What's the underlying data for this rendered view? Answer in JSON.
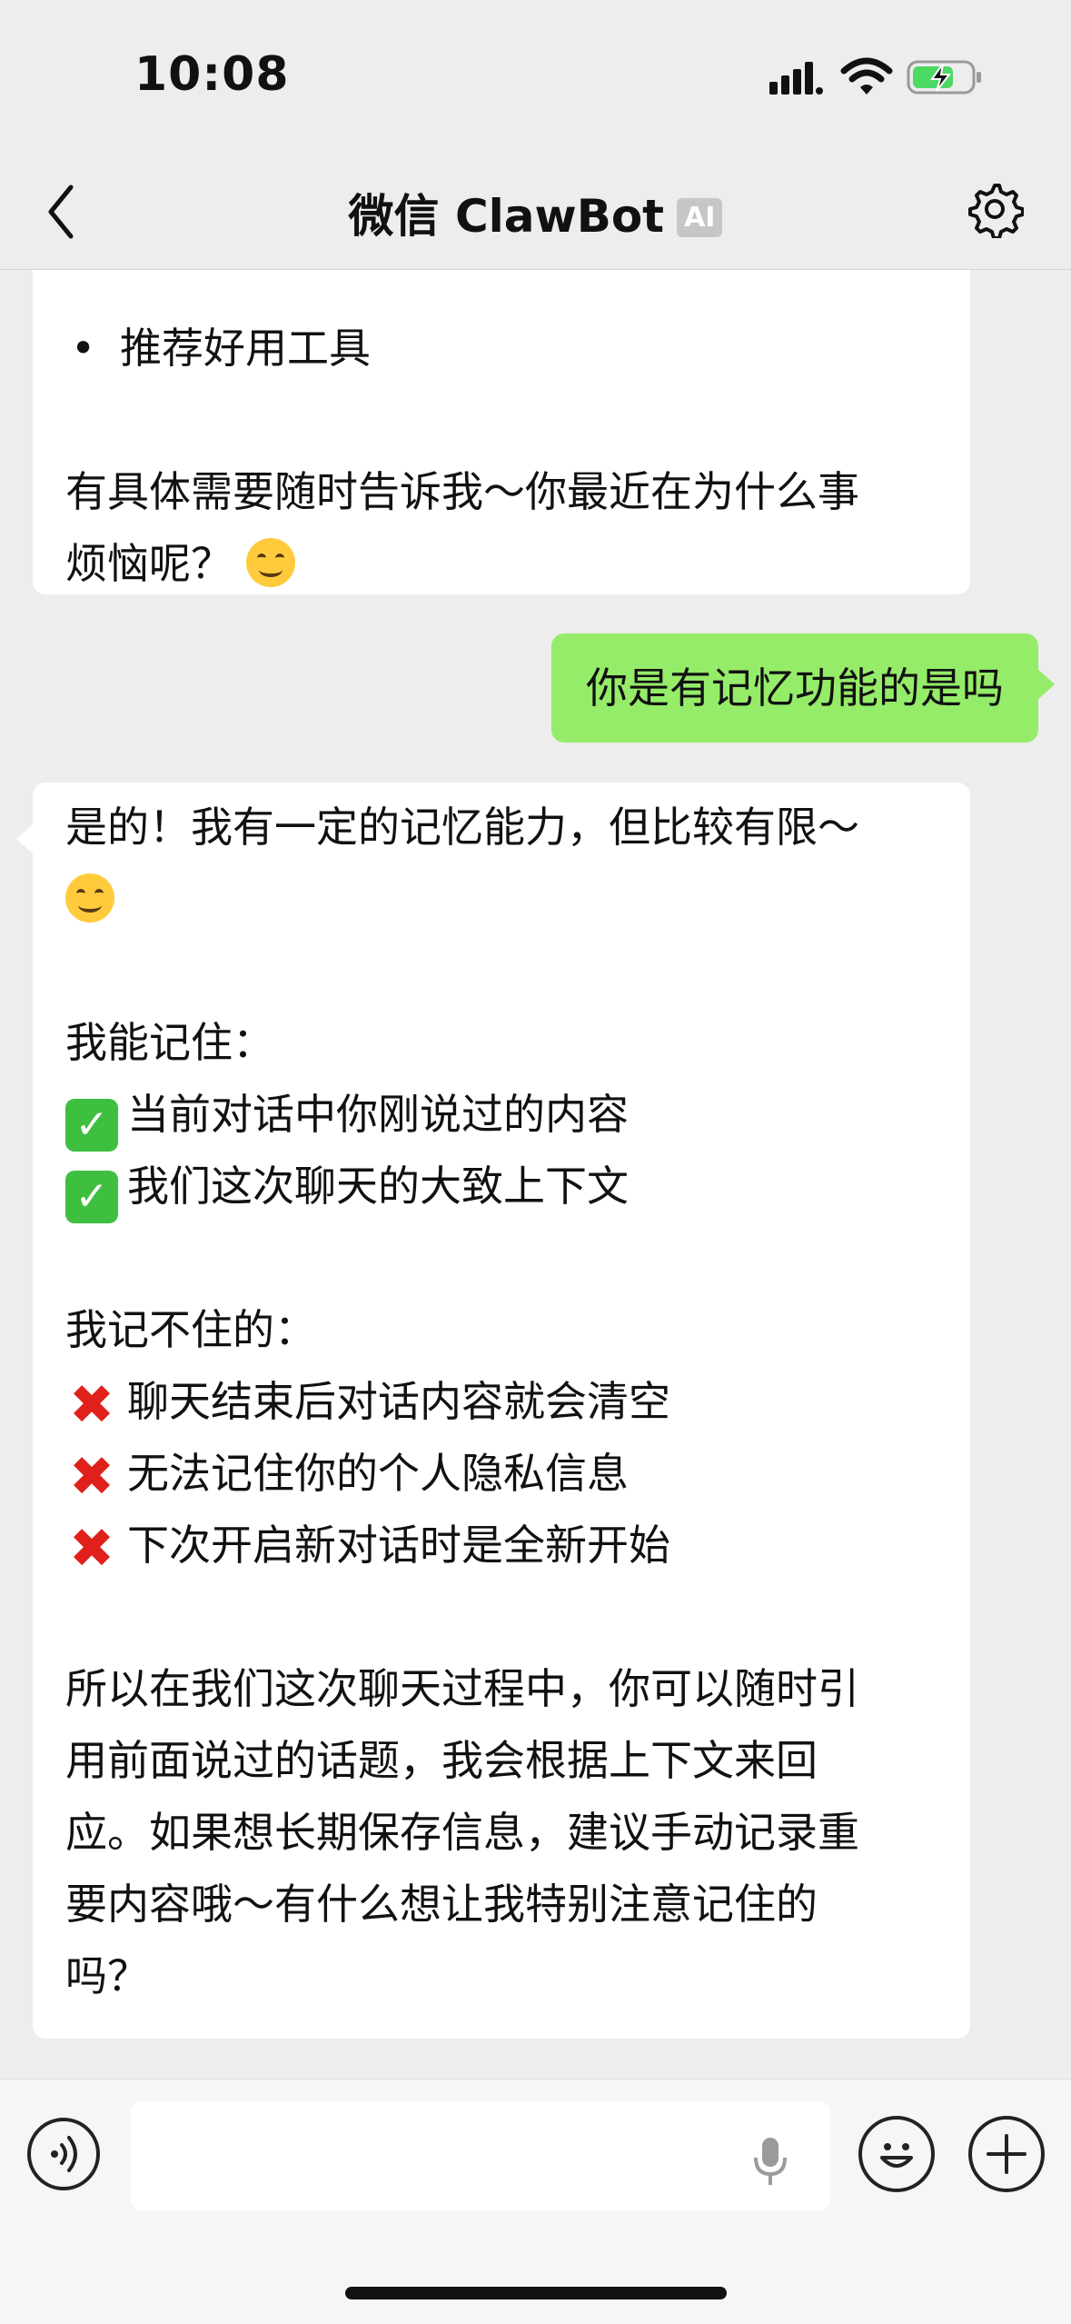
{
  "status_bar": {
    "time": "10:08"
  },
  "nav": {
    "title": "微信 ClawBot",
    "badge": "AI"
  },
  "messages": [
    {
      "from": "bot",
      "lines": [
        "推荐好用工具",
        "",
        "有具体需要随时告诉我～你最近在为什么事",
        "烦恼呢？"
      ]
    },
    {
      "from": "user",
      "text": "你是有记忆功能的是吗"
    },
    {
      "from": "bot",
      "lines": [
        "是的！我有一定的记忆能力，但比较有限～",
        "",
        "",
        "我能记住：",
        "当前对话中你刚说过的内容",
        "我们这次聊天的大致上下文",
        "",
        "我记不住的：",
        "聊天结束后对话内容就会清空",
        "无法记住你的个人隐私信息",
        "下次开启新对话时是全新开始",
        "",
        "所以在我们这次聊天过程中，你可以随时引",
        "用前面说过的话题，我会根据上下文来回",
        "应。如果想长期保存信息，建议手动记录重",
        "要内容哦～有什么想让我特别注意记住的",
        "吗？"
      ]
    }
  ],
  "icons": {
    "check_mark": "✓",
    "cross_mark": "✖",
    "bullet": "•"
  },
  "colors": {
    "user_bubble": "#95ec69",
    "background": "#ededed"
  }
}
